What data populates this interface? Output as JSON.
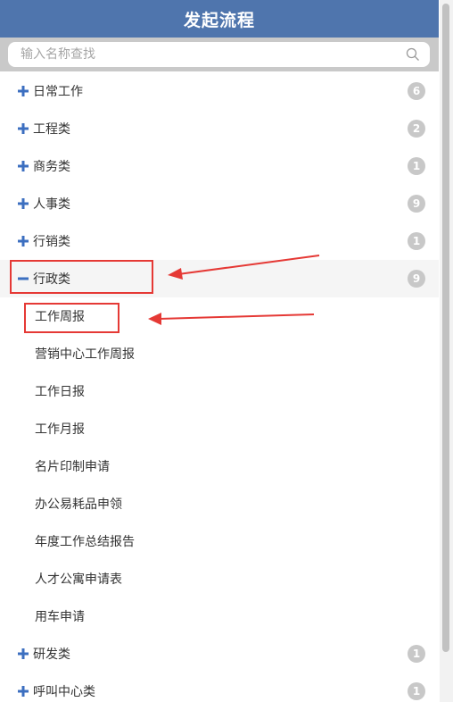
{
  "header": {
    "title": "发起流程"
  },
  "search": {
    "placeholder": "输入名称查找"
  },
  "categories": [
    {
      "label": "日常工作",
      "count": "6"
    },
    {
      "label": "工程类",
      "count": "2"
    },
    {
      "label": "商务类",
      "count": "1"
    },
    {
      "label": "人事类",
      "count": "9"
    },
    {
      "label": "行销类",
      "count": "1"
    },
    {
      "label": "行政类",
      "count": "9",
      "expanded": true
    }
  ],
  "admin_items": [
    "工作周报",
    "营销中心工作周报",
    "工作日报",
    "工作月报",
    "名片印制申请",
    "办公易耗品申领",
    "年度工作总结报告",
    "人才公寓申请表",
    "用车申请"
  ],
  "more_categories": [
    {
      "label": "研发类",
      "count": "1"
    },
    {
      "label": "呼叫中心类",
      "count": "1"
    }
  ],
  "colors": {
    "header": "#4f75ad",
    "toggle": "#3c6fc0",
    "badge": "#c8c8c8",
    "annotation": "#e53935"
  },
  "icons": {
    "expand": "plus-icon",
    "collapse": "minus-icon",
    "search": "search-icon"
  }
}
